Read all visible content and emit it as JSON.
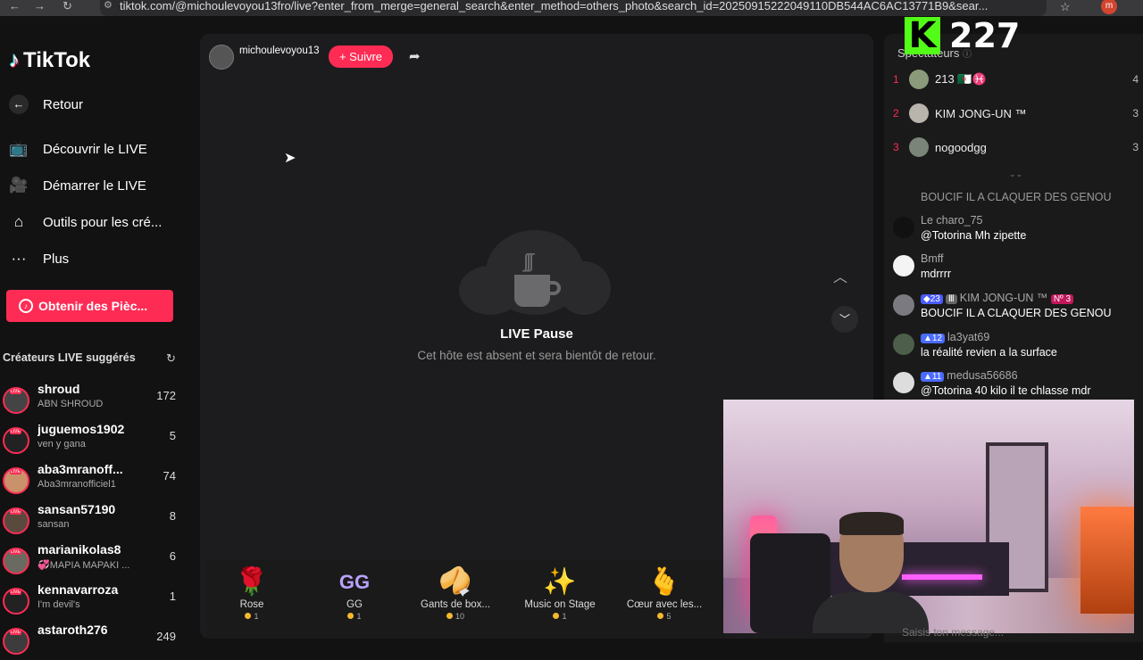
{
  "browser": {
    "url": "tiktok.com/@michoulevoyou13fro/live?enter_from_merge=general_search&enter_method=others_photo&search_id=20250915222049110DB544AC6AC13771B9&sear...",
    "profile_initial": "m"
  },
  "sidebar": {
    "logo_text": "TikTok",
    "back_label": "Retour",
    "nav": [
      {
        "label": "Découvrir le LIVE",
        "icon": "tv-icon"
      },
      {
        "label": "Démarrer le LIVE",
        "icon": "camera-icon"
      },
      {
        "label": "Outils pour les cré...",
        "icon": "house-icon"
      },
      {
        "label": "Plus",
        "icon": "more-icon"
      }
    ],
    "coins_button": "Obtenir des Pièc...",
    "suggested_title": "Créateurs LIVE suggérés",
    "creators": [
      {
        "name": "shroud",
        "sub": "ABN SHROUD",
        "count": "172"
      },
      {
        "name": "juguemos1902",
        "sub": "ven y gana",
        "count": "5"
      },
      {
        "name": "aba3mranoff...",
        "sub": "Aba3mranofficiel1",
        "count": "74"
      },
      {
        "name": "sansan57190",
        "sub": "sansan",
        "count": "8"
      },
      {
        "name": "marianikolas8",
        "sub": "💞MAPIA MAPAKI ...",
        "count": "6"
      },
      {
        "name": "kennavarroza",
        "sub": "I'm devil's",
        "count": "1"
      },
      {
        "name": "astaroth276",
        "sub": "",
        "count": "249"
      }
    ]
  },
  "player": {
    "host_name": "michoulevoyou13",
    "follow_label": "+ Suivre",
    "pause_title": "LIVE Pause",
    "pause_subtitle": "Cet hôte est absent et sera bientôt de retour."
  },
  "gifts": [
    {
      "name": "Rose",
      "price": "1",
      "icon": "🌹"
    },
    {
      "name": "GG",
      "price": "1",
      "icon": "GG"
    },
    {
      "name": "Gants de box...",
      "price": "10",
      "icon": "🥠"
    },
    {
      "name": "Music on Stage",
      "price": "1",
      "icon": "✨"
    },
    {
      "name": "Cœur avec les...",
      "price": "5",
      "icon": "🫰"
    }
  ],
  "overlay": {
    "kick_letter": "K",
    "kick_count": "227"
  },
  "panel": {
    "spectators_title": "Spectateurs",
    "viewers": [
      {
        "rank": "1",
        "name": "213 🇩🇿♓",
        "count": "4"
      },
      {
        "rank": "2",
        "name": "KIM JONG-UN ™",
        "count": "3"
      },
      {
        "rank": "3",
        "name": "nogoodgg",
        "count": "3"
      }
    ],
    "chat": [
      {
        "name": "",
        "text": "BOUCIF IL A CLAQUER DES GENOU",
        "badges": []
      },
      {
        "name": "Le charo_75",
        "text": "@Totorina Mh zipette",
        "badges": []
      },
      {
        "name": "Bmff",
        "text": "mdrrrr",
        "badges": []
      },
      {
        "name": "KIM JONG-UN ™",
        "text": "BOUCIF IL A CLAQUER DES GENOU",
        "badges": [
          "23",
          "Nº 3"
        ]
      },
      {
        "name": "la3yat69",
        "text": "la réalité revien a la surface",
        "badges": [
          "12"
        ]
      },
      {
        "name": "medusa56686",
        "text": "@Totorina 40 kilo il te chlasse mdr",
        "badges": [
          "11"
        ]
      }
    ],
    "chat_placeholder": "Saisis ton message..."
  }
}
